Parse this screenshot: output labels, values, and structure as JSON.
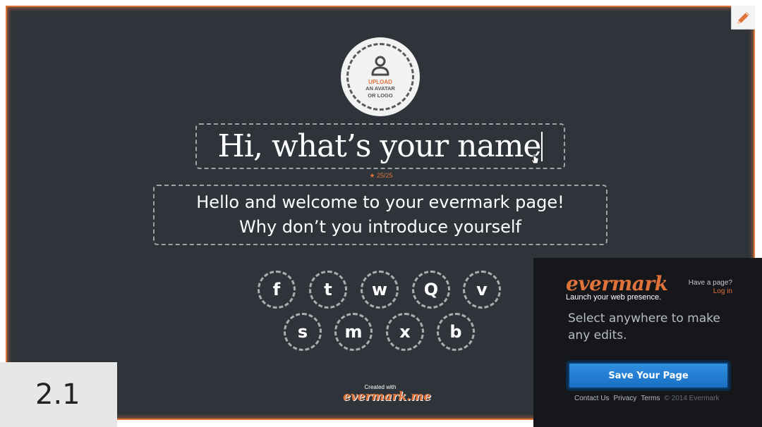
{
  "editor": {
    "avatar": {
      "upload_label": "UPLOAD",
      "sub_line1": "AN AVATAR",
      "sub_line2": "OR LOGO"
    },
    "name_field": {
      "value": "Hi, what’s your name",
      "char_count": "25/25"
    },
    "intro_field": {
      "line1": "Hello and welcome to your evermark page!",
      "line2": "Why don’t you introduce yourself"
    },
    "social_buttons": [
      "f",
      "t",
      "w",
      "Q",
      "v",
      "s",
      "m",
      "x",
      "b"
    ],
    "credit": {
      "small": "Created with",
      "logo": "evermark.me"
    }
  },
  "badge": {
    "text": "2.1"
  },
  "panel": {
    "brand": "evermark",
    "tagline": "Launch your web presence.",
    "have_page": "Have a page?",
    "login": "Log in",
    "instructions": "Select anywhere to make any edits.",
    "save_label": "Save Your Page",
    "links": {
      "contact": "Contact Us",
      "privacy": "Privacy",
      "terms": "Terms",
      "copyright": "© 2014 Evermark"
    }
  },
  "colors": {
    "accent": "#e0733a",
    "canvas": "#2f343b",
    "panel": "#15171a",
    "button": "#1a6fc4"
  },
  "icons": [
    "pencil-icon",
    "user-icon",
    "star-icon",
    "cursor-icon"
  ]
}
